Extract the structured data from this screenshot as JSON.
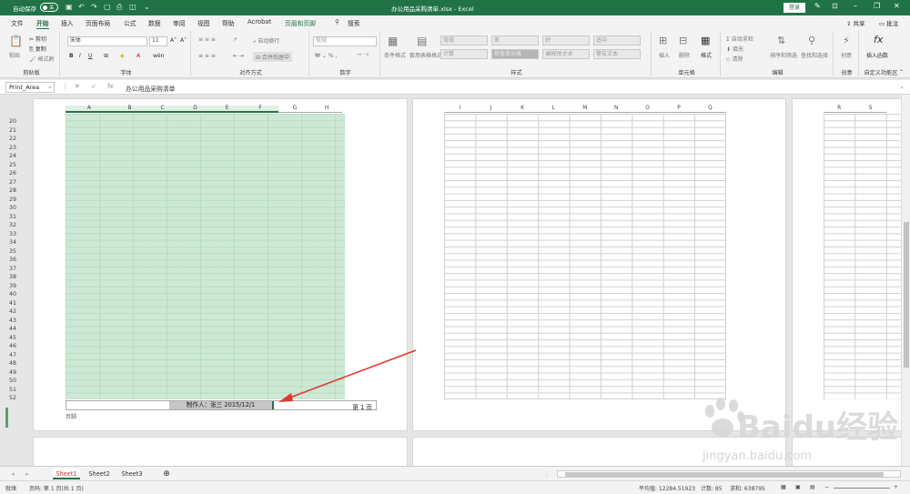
{
  "titlebar": {
    "autosave_label": "自动保存",
    "autosave_state": "关",
    "title": "办公用品采购清单.xlsx - Excel",
    "login": "登录"
  },
  "tabs": [
    "文件",
    "开始",
    "插入",
    "页面布局",
    "公式",
    "数据",
    "审阅",
    "视图",
    "帮助",
    "Acrobat",
    "页眉和页脚",
    "搜索"
  ],
  "active_tab": "开始",
  "share_label": "共享",
  "comment_label": "批注",
  "ribbon": {
    "clipboard": {
      "paste": "粘贴",
      "cut": "剪切",
      "copy": "复制",
      "painter": "格式刷",
      "group": "剪贴板"
    },
    "font": {
      "name": "宋体",
      "size": "11",
      "group": "字体"
    },
    "align": {
      "wrap": "自动换行",
      "merge": "合并后居中",
      "group": "对齐方式"
    },
    "number": {
      "format": "常规",
      "group": "数字"
    },
    "styles": {
      "cond": "条件格式",
      "table": "套用表格格式",
      "cells": [
        "常规",
        "差",
        "好",
        "适中",
        "计算",
        "检查单元格",
        "解释性文本",
        "警告文本"
      ],
      "group": "样式"
    },
    "cells": {
      "insert": "插入",
      "delete": "删除",
      "format": "格式",
      "group": "单元格"
    },
    "editing": {
      "sum": "自动求和",
      "fill": "填充",
      "clear": "清除",
      "sort": "排序和筛选",
      "find": "查找和选择",
      "group": "编辑"
    },
    "creative": {
      "label": "创意",
      "group": "创意"
    },
    "custom": {
      "label": "插入函数",
      "group": "自定义功能区"
    }
  },
  "formula_bar": {
    "name_box": "Print_Area",
    "formula": "办公用品采购清单"
  },
  "page1": {
    "columns": [
      "A",
      "B",
      "C",
      "D",
      "E",
      "F",
      "G",
      "H"
    ],
    "rows": [
      "20",
      "21",
      "22",
      "23",
      "24",
      "25",
      "26",
      "27",
      "28",
      "29",
      "30",
      "31",
      "32",
      "33",
      "34",
      "35",
      "36",
      "37",
      "38",
      "39",
      "40",
      "41",
      "42",
      "43",
      "44",
      "45",
      "46",
      "47",
      "48",
      "49",
      "50",
      "51",
      "52"
    ],
    "footer_center": "制作人：张三  2015/12/1",
    "footer_right": "第 1 页",
    "footer_label": "页脚"
  },
  "page2": {
    "columns": [
      "I",
      "J",
      "K",
      "L",
      "M",
      "N",
      "O",
      "P",
      "Q"
    ]
  },
  "page3": {
    "columns": [
      "R",
      "S"
    ]
  },
  "sheets": [
    "Sheet1",
    "Sheet2",
    "Sheet3"
  ],
  "active_sheet": "Sheet1",
  "status": {
    "mode": "就绪",
    "page_info": "页码: 第 1 页(共 1 页)",
    "average": "平均值: 12284.51923",
    "count": "计数: 85",
    "sum": "求和: 638795"
  },
  "watermark": {
    "text": "Baidu经验",
    "sub": "jingyan.baidu.com"
  },
  "colors": {
    "excel_green": "#217346",
    "print_area": "#cde8d4",
    "arrow": "#e0392b"
  }
}
